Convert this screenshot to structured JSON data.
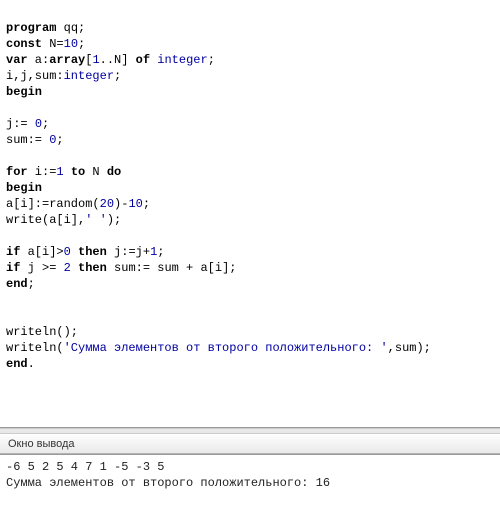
{
  "code": {
    "l1a": "program",
    "l1b": " qq;",
    "l2a": "const",
    "l2b": " N=",
    "l2n": "10",
    "l2c": ";",
    "l3a": "var",
    "l3b": " a:",
    "l3c": "array",
    "l3d": "[",
    "l3n1": "1",
    "l3e": "..N] ",
    "l3f": "of",
    "l3g": " ",
    "l3t": "integer",
    "l3h": ";",
    "l4a": "i,j,sum:",
    "l4t": "integer",
    "l4b": ";",
    "l5": "begin",
    "l7a": "j:= ",
    "l7n": "0",
    "l7b": ";",
    "l8a": "sum:= ",
    "l8n": "0",
    "l8b": ";",
    "l10a": "for",
    "l10b": " i:=",
    "l10n": "1",
    "l10c": " ",
    "l10d": "to",
    "l10e": " N ",
    "l10f": "do",
    "l11": "begin",
    "l12a": "a[i]:=random(",
    "l12n1": "20",
    "l12b": ")-",
    "l12n2": "10",
    "l12c": ";",
    "l13a": "write(a[i],",
    "l13s": "' '",
    "l13b": ");",
    "l15a": "if",
    "l15b": " a[i]>",
    "l15n": "0",
    "l15c": " ",
    "l15d": "then",
    "l15e": " j:=j+",
    "l15n2": "1",
    "l15f": ";",
    "l16a": "if",
    "l16b": " j >= ",
    "l16n": "2",
    "l16c": " ",
    "l16d": "then",
    "l16e": " sum:= sum + a[i];",
    "l17a": "end",
    "l17b": ";",
    "l19": "writeln();",
    "l20a": "writeln(",
    "l20s": "'Сумма элементов от второго положительного: '",
    "l20b": ",sum);",
    "l21a": "end",
    "l21b": "."
  },
  "output_panel": {
    "title": "Окно вывода",
    "line1": "-6 5 2 5 4 7 1 -5 -3 5 ",
    "line2": "Сумма элементов от второго положительного: 16"
  }
}
